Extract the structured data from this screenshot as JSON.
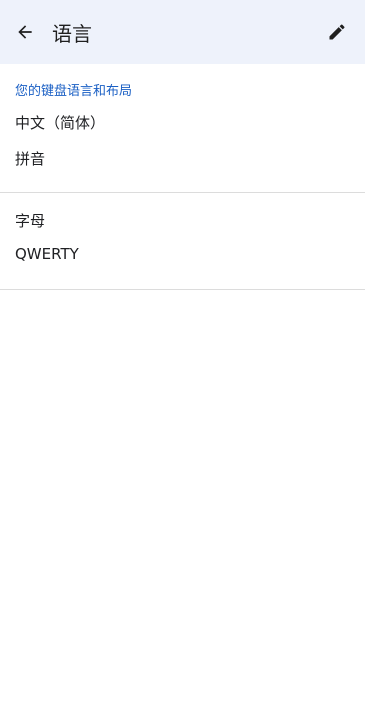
{
  "app_bar": {
    "title": "语言",
    "back_icon": "arrow-back-icon",
    "edit_icon": "pencil-edit-icon"
  },
  "section": {
    "header": "您的键盘语言和布局"
  },
  "languages": [
    {
      "language": "中文（简体）",
      "layout": "拼音"
    },
    {
      "language": "字母",
      "layout": "QWERTY"
    }
  ],
  "colors": {
    "app_bar_bg": "#eef2fb",
    "accent": "#1a5fc4",
    "divider": "#dcdcdc"
  }
}
